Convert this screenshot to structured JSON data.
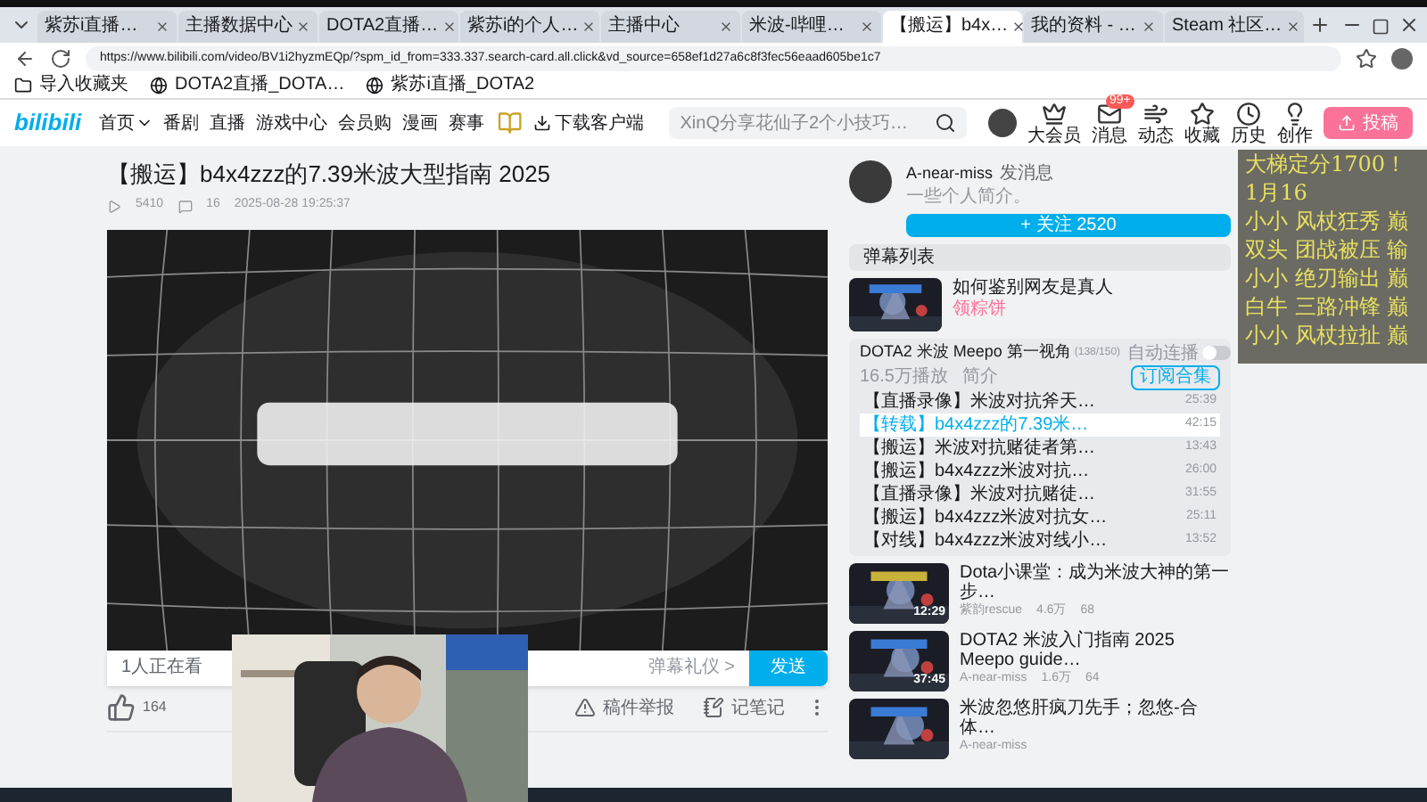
{
  "browser": {
    "tabs": [
      {
        "label": "紫苏i直播…",
        "selected": false
      },
      {
        "label": "主播数据中心",
        "selected": false
      },
      {
        "label": "DOTA2直播…",
        "selected": false
      },
      {
        "label": "紫苏i的个人…",
        "selected": false
      },
      {
        "label": "主播中心",
        "selected": false
      },
      {
        "label": "米波-哔哩…",
        "selected": false
      },
      {
        "label": "【搬运】b4x…",
        "selected": true
      },
      {
        "label": "我的资料 - …",
        "selected": false
      },
      {
        "label": "Steam 社区…",
        "selected": false
      }
    ],
    "url": "https://www.bilibili.com/video/BV1i2hyzmEQp/?spm_id_from=333.337.search-card.all.click&vd_source=658ef1d27a6c8f3fec56eaad605be1c7",
    "bookmarks": [
      "导入收藏夹",
      "DOTA2直播_DOTA…",
      "紫苏i直播_DOTA2"
    ]
  },
  "header": {
    "logo": "bilibili",
    "nav": [
      {
        "label": "首页",
        "kind": "menu"
      },
      {
        "label": "番剧",
        "kind": "link"
      },
      {
        "label": "直播",
        "kind": "link"
      },
      {
        "label": "游戏中心",
        "kind": "link"
      },
      {
        "label": "会员购",
        "kind": "link"
      },
      {
        "label": "漫画",
        "kind": "link"
      },
      {
        "label": "赛事",
        "kind": "link"
      },
      {
        "kind": "badge"
      },
      {
        "label": "下载客户端",
        "kind": "download"
      }
    ],
    "search_placeholder": "XinQ分享花仙子2个小技巧…",
    "icons": [
      {
        "label": "大会员",
        "kind": "vip"
      },
      {
        "label": "消息",
        "kind": "message",
        "badge": "99+"
      },
      {
        "label": "动态",
        "kind": "wind"
      },
      {
        "label": "收藏",
        "kind": "star"
      },
      {
        "label": "历史",
        "kind": "clock"
      },
      {
        "label": "创作",
        "kind": "bulb"
      }
    ],
    "upload": "投稿"
  },
  "video": {
    "title": "【搬运】b4x4zzz的7.39米波大型指南 2025",
    "views": "5410",
    "danmaku": "16",
    "date": "2025-08-28 19:25:37",
    "watching": "1人正在看",
    "etiquette": "弹幕礼仪 >",
    "send": "发送",
    "likes": "164",
    "report": "稿件举报",
    "notes": "记笔记"
  },
  "uploader": {
    "name": "A-near-miss",
    "message": "发消息",
    "bio": "一些个人简介。",
    "follow": "+ 关注 2520"
  },
  "danmaku_list": "弹幕列表",
  "ad": {
    "title": "如何鉴别网友是真人",
    "tag": "领粽饼"
  },
  "playlist": {
    "title": "DOTA2 米波 Meepo 第一视角",
    "count": "(138/150)",
    "autoplay_label": "自动连播",
    "autoplay": false,
    "plays": "16.5万播放",
    "intro": "简介",
    "subscribe": "订阅合集",
    "items": [
      {
        "title": "【直播录像】米波对抗斧天…",
        "duration": "25:39",
        "selected": false
      },
      {
        "title": "【转载】b4x4zzz的7.39米…",
        "duration": "42:15",
        "selected": true
      },
      {
        "title": "【搬运】米波对抗赌徒者第…",
        "duration": "13:43",
        "selected": false
      },
      {
        "title": "【搬运】b4x4zzz米波对抗…",
        "duration": "26:00",
        "selected": false
      },
      {
        "title": "【直播录像】米波对抗赌徒…",
        "duration": "31:55",
        "selected": false
      },
      {
        "title": "【搬运】b4x4zzz米波对抗女…",
        "duration": "25:11",
        "selected": false
      },
      {
        "title": "【对线】b4x4zzz米波对线小…",
        "duration": "13:52",
        "selected": false
      }
    ]
  },
  "recommended": [
    {
      "title": "Dota小课堂：成为米波大神的第一步…",
      "author": "紫韵rescue",
      "plays": "4.6万",
      "comments": "68",
      "duration": "12:29"
    },
    {
      "title": "DOTA2 米波入门指南 2025 Meepo guide…",
      "author": "A-near-miss",
      "plays": "1.6万",
      "comments": "64",
      "duration": "37:45"
    },
    {
      "title": "米波忽悠肝疯刀先手；忽悠-合体…",
      "author": "A-near-miss"
    }
  ],
  "overlay": [
    "大梯定分1700！",
    "1月16",
    "小小 风杖狂秀 巅",
    "双头 团战被压 输",
    "小小 绝刃输出 巅",
    "白牛 三路冲锋 巅",
    "小小 风杖拉扯 巅"
  ]
}
